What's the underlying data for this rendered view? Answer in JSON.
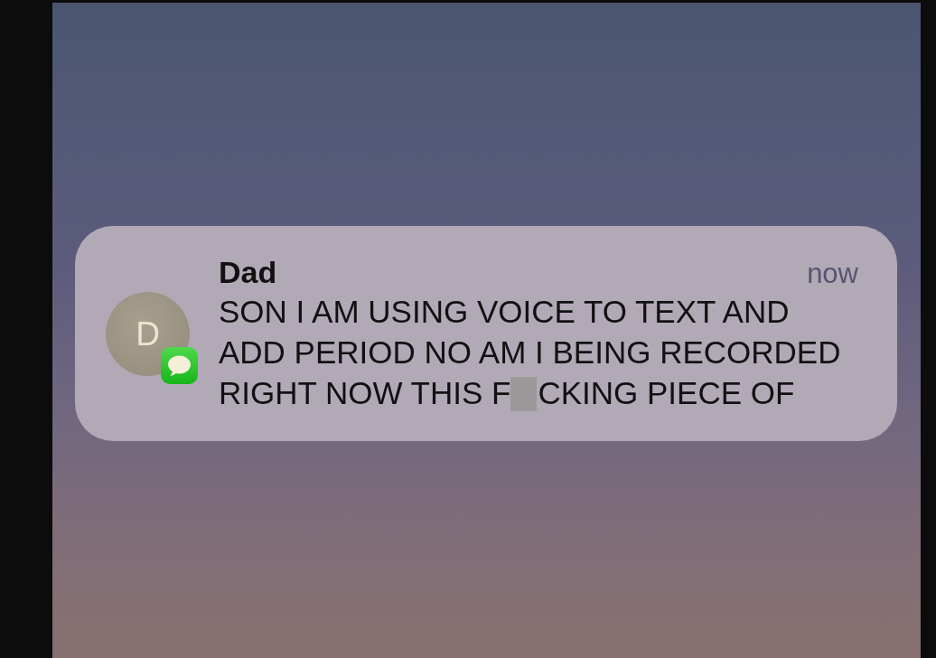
{
  "notification": {
    "sender": "Dad",
    "time": "now",
    "avatar": {
      "initial": "D"
    },
    "message_lines": [
      {
        "segments": [
          {
            "kind": "text",
            "text": "SON I AM USING VOICE TO TEXT AND"
          }
        ]
      },
      {
        "segments": [
          {
            "kind": "text",
            "text": "ADD PERIOD NO AM I BEING RECORDED"
          }
        ]
      },
      {
        "segments": [
          {
            "kind": "text",
            "text": "RIGHT NOW THIS F"
          },
          {
            "kind": "redaction"
          },
          {
            "kind": "text",
            "text": "CKING PIECE OF"
          }
        ]
      }
    ]
  }
}
